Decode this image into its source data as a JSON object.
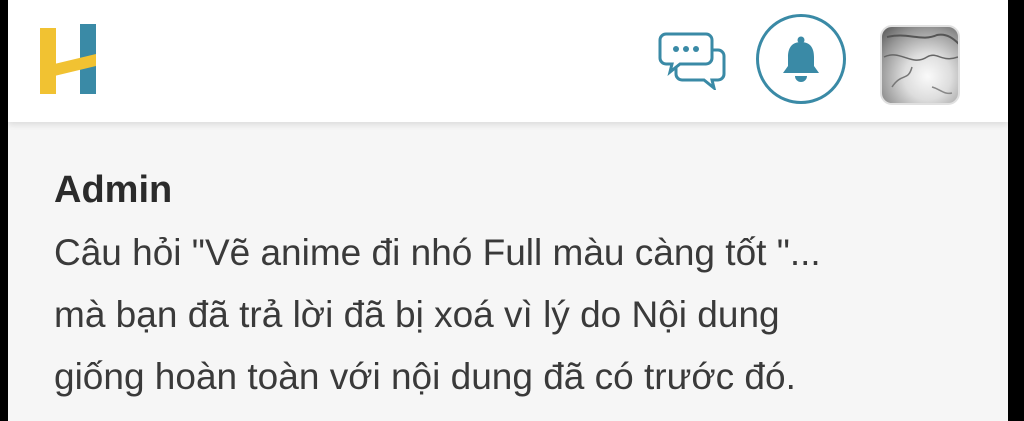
{
  "header": {
    "logo_icon": "h-logo-icon",
    "chat_icon": "chat-bubbles-icon",
    "bell_icon": "bell-icon",
    "avatar_icon": "user-avatar",
    "accent_color": "#3a8aa6",
    "logo_colors": [
      "#f1c232",
      "#3a8aa6"
    ]
  },
  "notification": {
    "sender": "Admin",
    "lines": [
      "Câu hỏi \"Vẽ anime đi nhó Full màu càng tốt \"...",
      "mà bạn đã trả lời đã bị xoá vì lý do Nội dung",
      "giống hoàn toàn với nội dung đã có trước đó."
    ]
  }
}
